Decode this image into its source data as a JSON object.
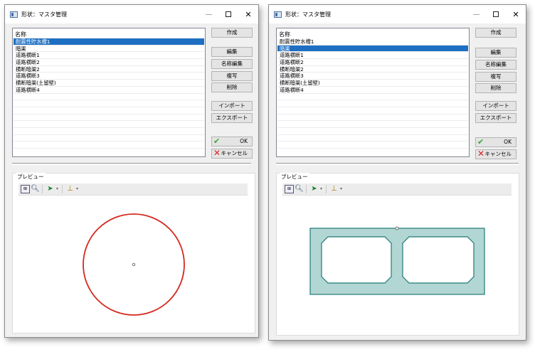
{
  "windows": [
    {
      "title": "形状：マスタ管理",
      "list_header": "名称",
      "items": [
        "耐震性貯水槽1",
        "暗渠",
        "道路横断1",
        "道路横断2",
        "横断暗渠2",
        "道路横断3",
        "横断暗渠(土留壁)",
        "道路横断4"
      ],
      "selected_index": 0,
      "buttons": {
        "create": "作成",
        "edit": "編集",
        "rename": "名称編集",
        "copy": "複写",
        "delete": "削除",
        "import": "インポート",
        "export": "エクスポート",
        "ok": "OK",
        "cancel": "キャンセル"
      },
      "preview_label": "プレビュー",
      "preview_shape": "circle",
      "shape_stroke": "#d42a1f"
    },
    {
      "title": "形状：マスタ管理",
      "list_header": "名称",
      "items": [
        "耐震性貯水槽1",
        "暗渠",
        "道路横断1",
        "道路横断2",
        "横断暗渠2",
        "道路横断3",
        "横断暗渠(土留壁)",
        "道路横断4"
      ],
      "selected_index": 1,
      "buttons": {
        "create": "作成",
        "edit": "編集",
        "rename": "名称編集",
        "copy": "複写",
        "delete": "削除",
        "import": "インポート",
        "export": "エクスポート",
        "ok": "OK",
        "cancel": "キャンセル"
      },
      "preview_label": "プレビュー",
      "preview_shape": "box-culvert",
      "shape_fill": "#b2d6d3",
      "shape_stroke": "#1f7a75"
    }
  ],
  "colors": {
    "selection": "#1e6fc2",
    "ok": "#3aa635",
    "cancel": "#dd2222"
  },
  "icons": [
    "window-icon",
    "fit-view-icon",
    "zoom-icon",
    "select-arrow-icon",
    "dimension-icon",
    "minimize-icon",
    "maximize-icon",
    "close-icon",
    "check-icon",
    "x-icon"
  ]
}
